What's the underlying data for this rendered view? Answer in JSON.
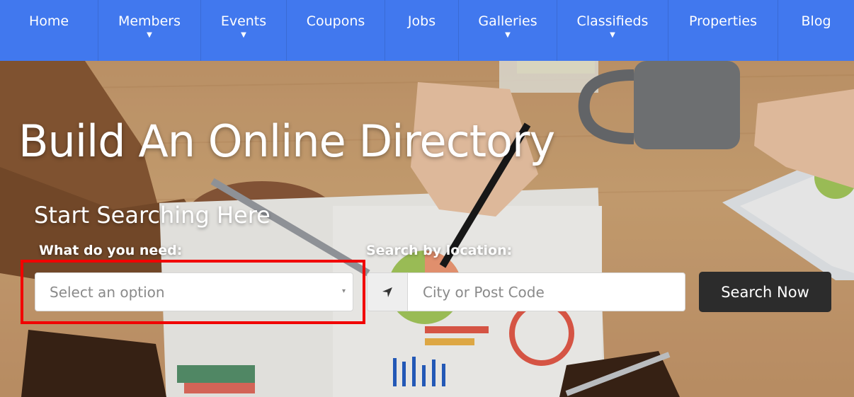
{
  "nav": {
    "items": [
      {
        "label": "Home",
        "dropdown": false
      },
      {
        "label": "Members",
        "dropdown": true
      },
      {
        "label": "Events",
        "dropdown": true
      },
      {
        "label": "Coupons",
        "dropdown": false
      },
      {
        "label": "Jobs",
        "dropdown": false
      },
      {
        "label": "Galleries",
        "dropdown": true
      },
      {
        "label": "Classifieds",
        "dropdown": true
      },
      {
        "label": "Properties",
        "dropdown": false
      },
      {
        "label": "Blog",
        "dropdown": false
      }
    ],
    "caret": "▼"
  },
  "hero": {
    "title": "Build An Online Directory",
    "subtitle": "Start Searching Here",
    "need_label": "What do you need:",
    "location_label": "Search by location:",
    "select_placeholder": "Select an option",
    "select_caret": "▾",
    "location_placeholder": "City or Post Code",
    "location_icon": "location-arrow-icon",
    "search_button": "Search Now"
  },
  "colors": {
    "nav_bg": "#4178ee",
    "button_bg": "#2c2c2c",
    "highlight": "#f10000"
  }
}
